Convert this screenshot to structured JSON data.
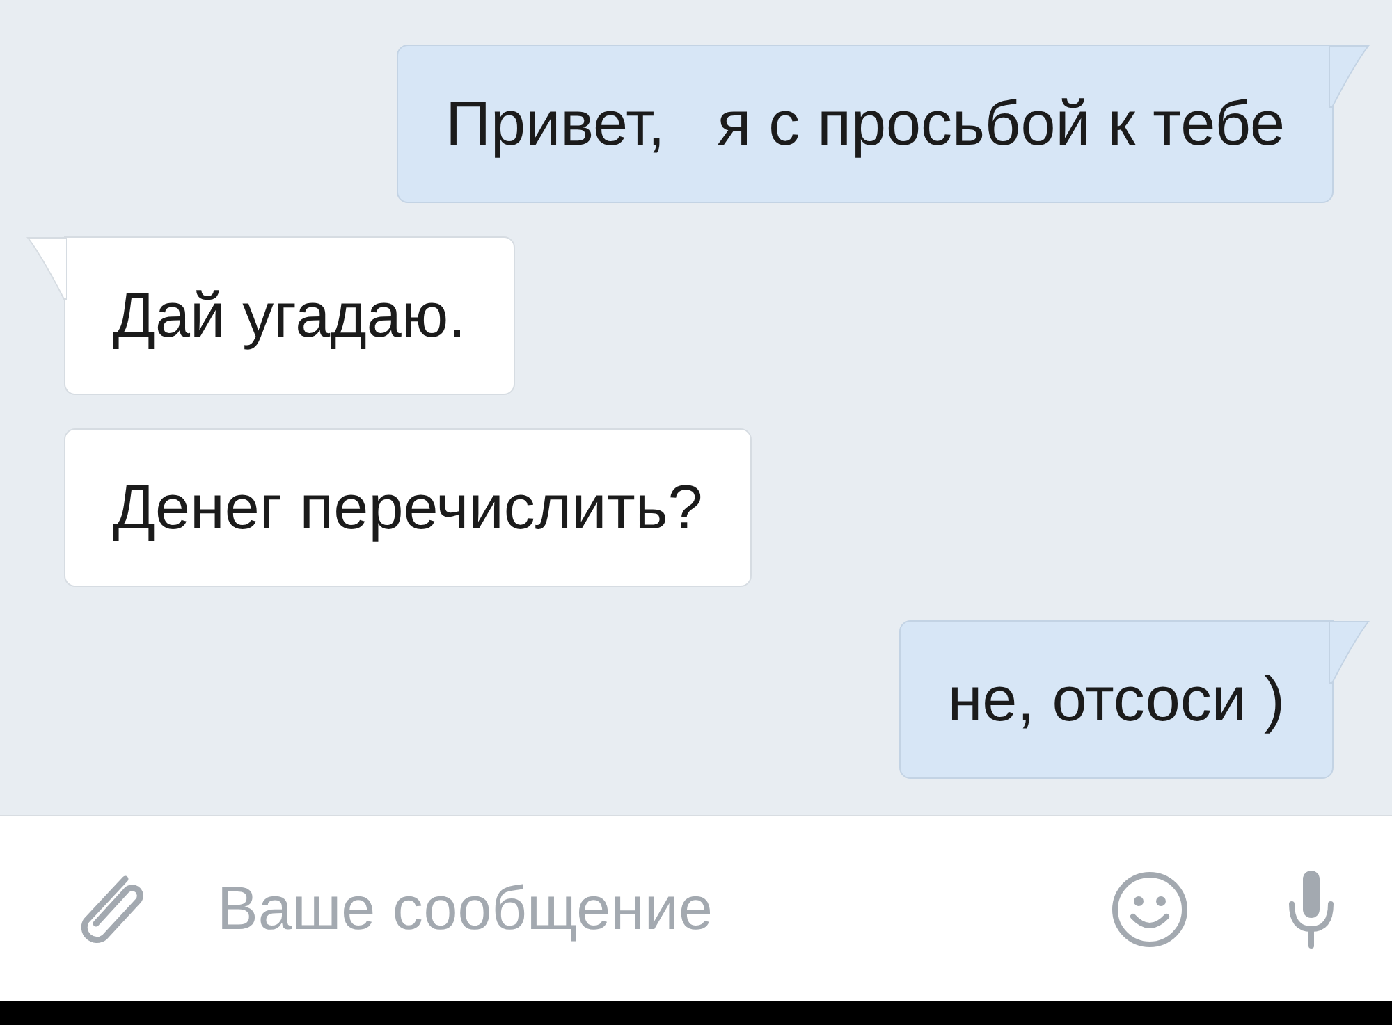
{
  "messages": [
    {
      "outgoing": true,
      "text": "Привет,   я с просьбой к тебе",
      "tail": true
    },
    {
      "outgoing": false,
      "text": "Дай угадаю.",
      "tail": true
    },
    {
      "outgoing": false,
      "text": "Денег перечислить?",
      "tail": false
    },
    {
      "outgoing": true,
      "text": "не, отсоси )",
      "tail": true
    }
  ],
  "composer": {
    "placeholder": "Ваше сообщение"
  }
}
